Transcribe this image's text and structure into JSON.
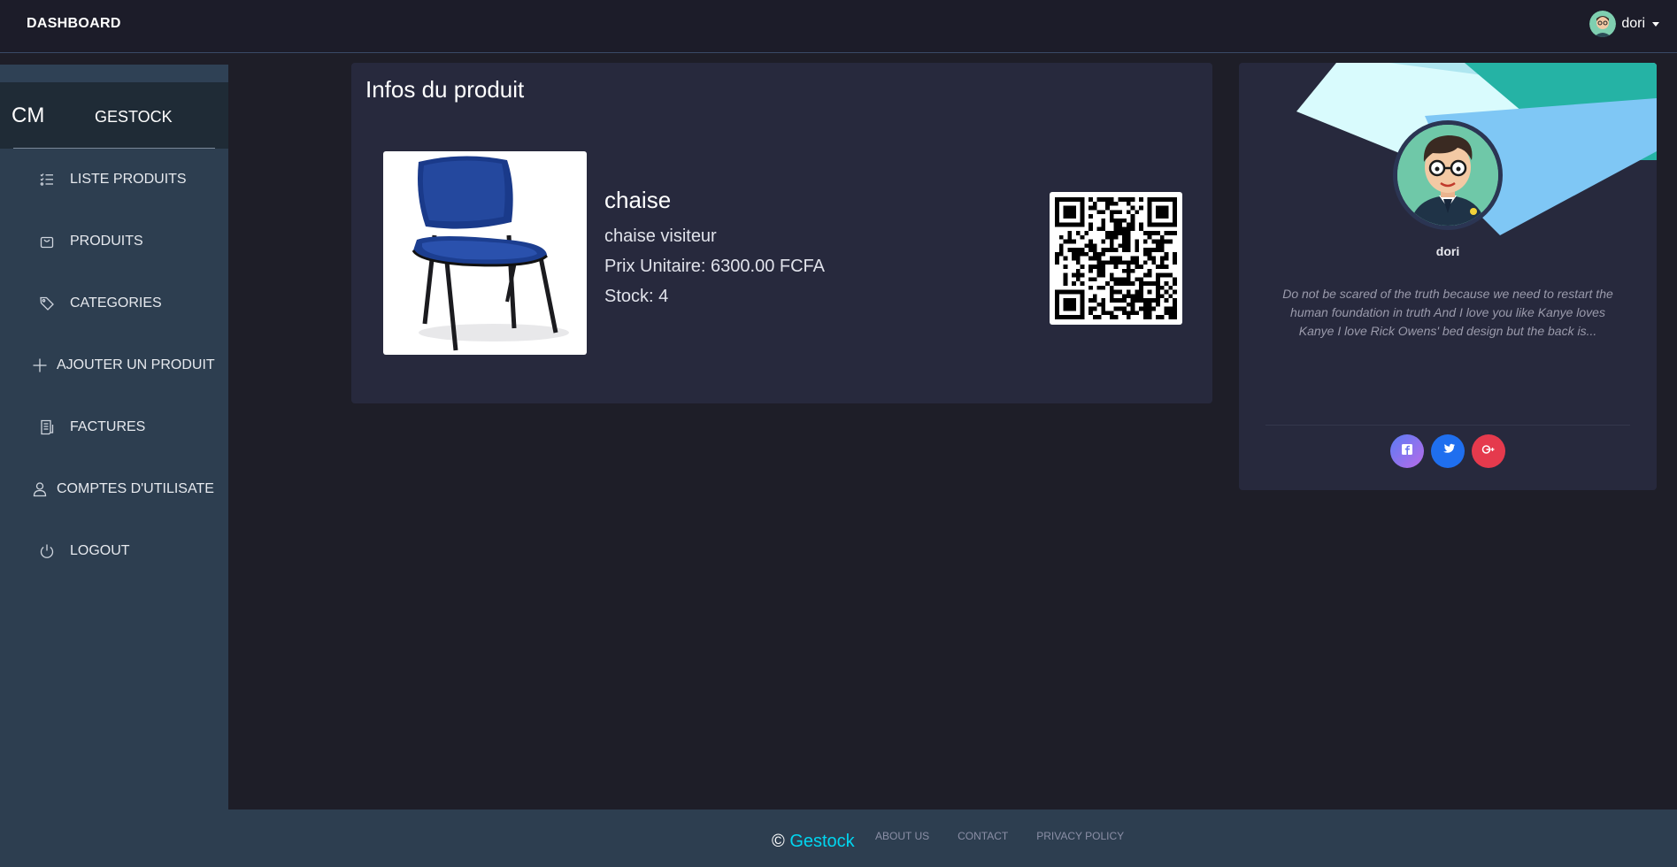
{
  "topbar": {
    "brand": "DASHBOARD",
    "user": {
      "name": "dori",
      "avatar": "user-avatar"
    }
  },
  "sidebar": {
    "logo_mini": "CM",
    "logo_text": "GESTOCK",
    "items": [
      {
        "label": "LISTE PRODUITS",
        "icon": "list-icon"
      },
      {
        "label": "PRODUITS",
        "icon": "shopping-bag-icon"
      },
      {
        "label": "CATEGORIES",
        "icon": "tag-icon"
      },
      {
        "label": "AJOUTER UN PRODUIT",
        "icon": "plus-icon"
      },
      {
        "label": "FACTURES",
        "icon": "receipt-icon"
      },
      {
        "label": "COMPTES D'UTILISATE",
        "icon": "user-icon"
      },
      {
        "label": "LOGOUT",
        "icon": "power-icon"
      }
    ]
  },
  "product": {
    "section_title": "Infos du produit",
    "name": "chaise",
    "description": "chaise visiteur",
    "price": "Prix Unitaire: 6300.00 FCFA",
    "stock": "Stock: 4",
    "image": "blue-chair-image",
    "qr": "qr-code-image"
  },
  "profile": {
    "name": "dori",
    "bio": "Do not be scared of the truth because we need to restart the human foundation in truth And I love you like Kanye loves Kanye I love Rick Owens' bed design but the back is...",
    "socials": [
      {
        "icon": "facebook-icon",
        "color": "#5b7cf5"
      },
      {
        "icon": "twitter-icon",
        "color": "#1f6fef"
      },
      {
        "icon": "google-plus-icon",
        "color": "#e53a4d"
      }
    ]
  },
  "footer": {
    "copyright_symbol": "©",
    "brand": "Gestock",
    "brand_color": "#00d6f0",
    "links": [
      "ABOUT US",
      "CONTACT",
      "PRIVACY POLICY"
    ]
  },
  "colors": {
    "background": "#1e1e28",
    "card": "#27293d",
    "sidebar": "#2d3e50",
    "accent": "#00d6f0"
  }
}
